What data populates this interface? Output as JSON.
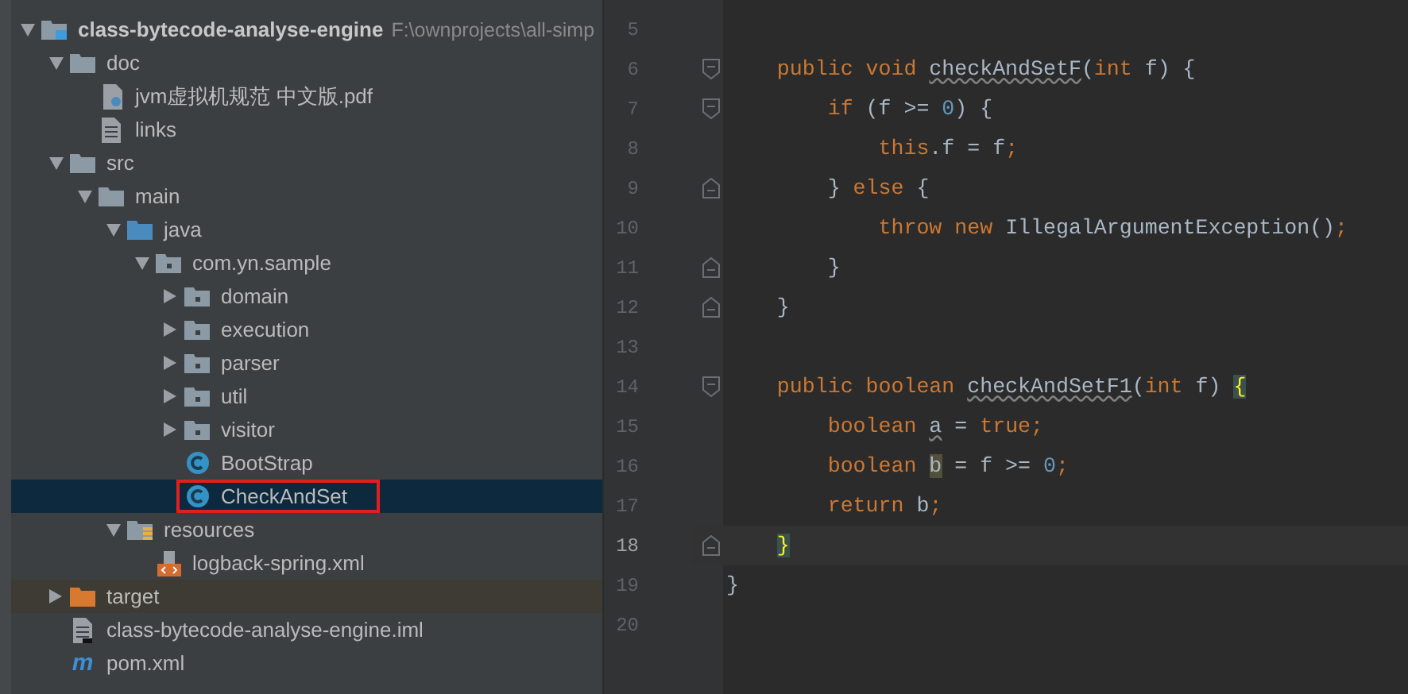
{
  "project_tree": [
    {
      "label": "class-bytecode-analyse-engine",
      "hint": "F:\\ownprojects\\all-simp",
      "kind": "module",
      "expanded": true,
      "selected": false,
      "children": [
        {
          "label": "doc",
          "kind": "folder",
          "expanded": true,
          "selected": false,
          "children": [
            {
              "label": "jvm虚拟机规范 中文版.pdf",
              "kind": "pdf",
              "selected": false
            },
            {
              "label": "links",
              "kind": "text",
              "selected": false
            }
          ]
        },
        {
          "label": "src",
          "kind": "folder",
          "expanded": true,
          "selected": false,
          "children": [
            {
              "label": "main",
              "kind": "folder",
              "expanded": true,
              "selected": false,
              "children": [
                {
                  "label": "java",
                  "kind": "source-folder",
                  "expanded": true,
                  "selected": false,
                  "children": [
                    {
                      "label": "com.yn.sample",
                      "kind": "package",
                      "expanded": true,
                      "selected": false,
                      "children": [
                        {
                          "label": "domain",
                          "kind": "package",
                          "expanded": false,
                          "selected": false
                        },
                        {
                          "label": "execution",
                          "kind": "package",
                          "expanded": false,
                          "selected": false
                        },
                        {
                          "label": "parser",
                          "kind": "package",
                          "expanded": false,
                          "selected": false
                        },
                        {
                          "label": "util",
                          "kind": "package",
                          "expanded": false,
                          "selected": false
                        },
                        {
                          "label": "visitor",
                          "kind": "package",
                          "expanded": false,
                          "selected": false
                        },
                        {
                          "label": "BootStrap",
                          "kind": "class",
                          "selected": false
                        },
                        {
                          "label": "CheckAndSet",
                          "kind": "class",
                          "selected": true,
                          "boxed": true
                        }
                      ]
                    }
                  ]
                },
                {
                  "label": "resources",
                  "kind": "resources-folder",
                  "expanded": true,
                  "selected": false,
                  "children": [
                    {
                      "label": "logback-spring.xml",
                      "kind": "xml",
                      "selected": false
                    }
                  ]
                }
              ]
            }
          ]
        },
        {
          "label": "target",
          "kind": "excluded-folder",
          "expanded": false,
          "selected": false,
          "excluded": true
        },
        {
          "label": "class-bytecode-analyse-engine.iml",
          "kind": "iml",
          "selected": false
        },
        {
          "label": "pom.xml",
          "kind": "maven",
          "icon_text": "m",
          "selected": false
        }
      ]
    }
  ],
  "editor": {
    "lines": [
      {
        "number": "5",
        "current": false
      },
      {
        "number": "6",
        "current": false,
        "fold_start": true,
        "tokens": [
          {
            "kind": "keyword",
            "text": "    public void "
          },
          {
            "kind": "unused",
            "text": "checkAndSetF"
          },
          {
            "kind": "plain",
            "text": "("
          },
          {
            "kind": "keyword",
            "text": "int "
          },
          {
            "kind": "plain",
            "text": "f) {"
          }
        ]
      },
      {
        "number": "7",
        "current": false,
        "fold_start": true,
        "tokens": [
          {
            "kind": "keyword",
            "text": "        if "
          },
          {
            "kind": "plain",
            "text": "(f >= "
          },
          {
            "kind": "number",
            "text": "0"
          },
          {
            "kind": "plain",
            "text": ") {"
          }
        ]
      },
      {
        "number": "8",
        "current": false,
        "tokens": [
          {
            "kind": "keyword",
            "text": "            this"
          },
          {
            "kind": "plain",
            "text": ".f = f"
          },
          {
            "kind": "keyword",
            "text": ";"
          }
        ]
      },
      {
        "number": "9",
        "current": false,
        "fold_end": true,
        "tokens": [
          {
            "kind": "plain",
            "text": "        } "
          },
          {
            "kind": "keyword",
            "text": "else "
          },
          {
            "kind": "plain",
            "text": "{"
          }
        ]
      },
      {
        "number": "10",
        "current": false,
        "tokens": [
          {
            "kind": "keyword",
            "text": "            throw new "
          },
          {
            "kind": "plain",
            "text": "IllegalArgumentException()"
          },
          {
            "kind": "keyword",
            "text": ";"
          }
        ]
      },
      {
        "number": "11",
        "current": false,
        "fold_end": true,
        "tokens": [
          {
            "kind": "plain",
            "text": "        }"
          }
        ]
      },
      {
        "number": "12",
        "current": false,
        "fold_end": true,
        "tokens": [
          {
            "kind": "plain",
            "text": "    }"
          }
        ]
      },
      {
        "number": "13",
        "current": false
      },
      {
        "number": "14",
        "current": false,
        "fold_start": true,
        "tokens": [
          {
            "kind": "keyword",
            "text": "    public boolean "
          },
          {
            "kind": "unused",
            "text": "checkAndSetF1"
          },
          {
            "kind": "plain",
            "text": "("
          },
          {
            "kind": "keyword",
            "text": "int "
          },
          {
            "kind": "plain",
            "text": "f) "
          },
          {
            "kind": "brace-match",
            "text": "{"
          }
        ]
      },
      {
        "number": "15",
        "current": false,
        "tokens": [
          {
            "kind": "keyword",
            "text": "        boolean "
          },
          {
            "kind": "unused-var",
            "text": "a"
          },
          {
            "kind": "plain",
            "text": " = "
          },
          {
            "kind": "keyword",
            "text": "true;"
          }
        ]
      },
      {
        "number": "16",
        "current": false,
        "tokens": [
          {
            "kind": "keyword",
            "text": "        boolean "
          },
          {
            "kind": "usage",
            "text": "b"
          },
          {
            "kind": "plain",
            "text": " = f >= "
          },
          {
            "kind": "number",
            "text": "0"
          },
          {
            "kind": "keyword",
            "text": ";"
          }
        ]
      },
      {
        "number": "17",
        "current": false,
        "tokens": [
          {
            "kind": "keyword",
            "text": "        return "
          },
          {
            "kind": "plain",
            "text": "b"
          },
          {
            "kind": "keyword",
            "text": ";"
          }
        ]
      },
      {
        "number": "18",
        "current": true,
        "fold_end": true,
        "tokens": [
          {
            "kind": "brace-match",
            "text": "    }"
          }
        ]
      },
      {
        "number": "19",
        "current": false,
        "tokens": [
          {
            "kind": "plain",
            "text": "}"
          }
        ]
      },
      {
        "number": "20",
        "current": false
      }
    ]
  }
}
